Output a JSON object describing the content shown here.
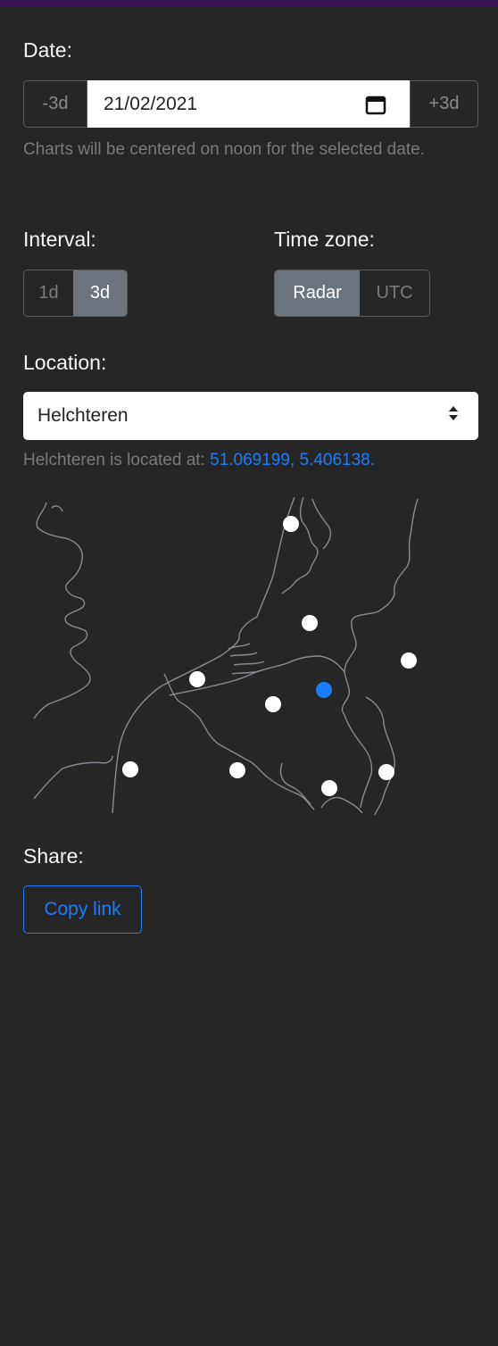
{
  "date": {
    "label": "Date:",
    "minus_label": "-3d",
    "value": "21/02/2021",
    "plus_label": "+3d",
    "hint": "Charts will be centered on noon for the selected date."
  },
  "interval": {
    "label": "Interval:",
    "options": [
      "1d",
      "3d"
    ],
    "selected": "3d"
  },
  "timezone": {
    "label": "Time zone:",
    "options": [
      "Radar",
      "UTC"
    ],
    "selected": "Radar"
  },
  "location": {
    "label": "Location:",
    "selected": "Helchteren",
    "info_prefix": "Helchteren is located at: ",
    "coords": "51.069199, 5.406138."
  },
  "map": {
    "marker_color": "#ffffff",
    "selected_marker_color": "#1a7cff",
    "border_color": "#8a8a94"
  },
  "share": {
    "label": "Share:",
    "copy_label": "Copy link"
  },
  "colors": {
    "accent": "#1a7cff",
    "background": "#262626",
    "active_toggle": "#6c757d"
  }
}
